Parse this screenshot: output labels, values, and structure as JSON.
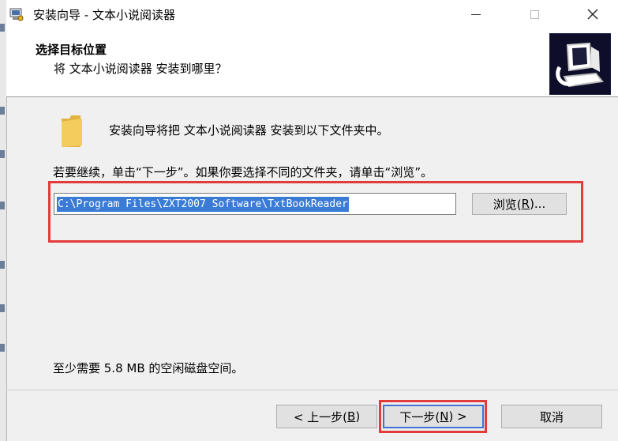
{
  "window": {
    "title": "安装向导 - 文本小说阅读器",
    "app_icon": "installer-icon",
    "controls": {
      "minimize_icon": "minimize-icon",
      "maximize_icon": "maximize-icon",
      "close_icon": "close-icon"
    }
  },
  "header": {
    "title": "选择目标位置",
    "subtitle": "将 文本小说阅读器 安装到哪里？",
    "logo_icon": "computer-install-icon"
  },
  "body": {
    "folder_icon": "folder-icon",
    "intro": "安装向导将把 文本小说阅读器 安装到以下文件夹中。",
    "instruction": "若要继续，单击“下一步”。如果你要选择不同的文件夹，请单击“浏览”。",
    "path_value": "C:\\Program Files\\ZXT2007 Software\\TxtBookReader",
    "browse_label": "浏览(",
    "browse_key": "R",
    "browse_suffix": ")...",
    "space_text": "至少需要 5.8 MB 的空闲磁盘空间。"
  },
  "footer": {
    "back_label": "< 上一步(",
    "back_key": "B",
    "back_suffix": ")",
    "next_label": "下一步(",
    "next_key": "N",
    "next_suffix": ") >",
    "cancel_label": "取消"
  },
  "colors": {
    "highlight_red": "#e23b3b",
    "selection_blue": "#3a7bd5",
    "default_button_border": "#3f74d4"
  }
}
